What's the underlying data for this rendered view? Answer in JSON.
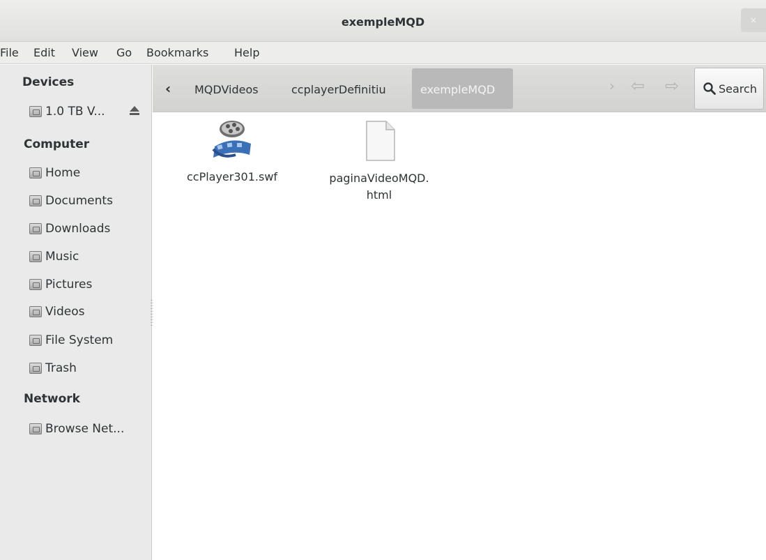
{
  "window": {
    "title": "exempleMQD",
    "close_glyph": "×"
  },
  "menu": [
    "File",
    "Edit",
    "View",
    "Go",
    "Bookmarks",
    "Help"
  ],
  "sidebar": {
    "devices_header": "Devices",
    "device": {
      "label": "1.0 TB V...",
      "icon": "drive-icon"
    },
    "computer_header": "Computer",
    "computer_items": [
      {
        "label": "Home",
        "icon": "home-folder-icon"
      },
      {
        "label": "Documents",
        "icon": "documents-folder-icon"
      },
      {
        "label": "Downloads",
        "icon": "downloads-folder-icon"
      },
      {
        "label": "Music",
        "icon": "music-folder-icon"
      },
      {
        "label": "Pictures",
        "icon": "pictures-folder-icon"
      },
      {
        "label": "Videos",
        "icon": "videos-folder-icon"
      },
      {
        "label": "File System",
        "icon": "filesystem-icon"
      },
      {
        "label": "Trash",
        "icon": "trash-icon"
      }
    ],
    "network_header": "Network",
    "network_items": [
      {
        "label": "Browse Net...",
        "icon": "network-icon"
      }
    ]
  },
  "pathbar": {
    "back_glyph": "‹",
    "crumbs": [
      "MQDVideos",
      "ccplayerDefinitiu",
      "exempleMQD"
    ],
    "search_label": "Search"
  },
  "files": [
    {
      "name": "ccPlayer301.swf",
      "icon": "video-file-icon"
    },
    {
      "name": "paginaVideoMQD.",
      "name_line2": "html",
      "icon": "html-file-icon"
    }
  ],
  "colors": {
    "active_crumb": "#b9b9b9",
    "sidebar_bg": "#eaeaea"
  }
}
